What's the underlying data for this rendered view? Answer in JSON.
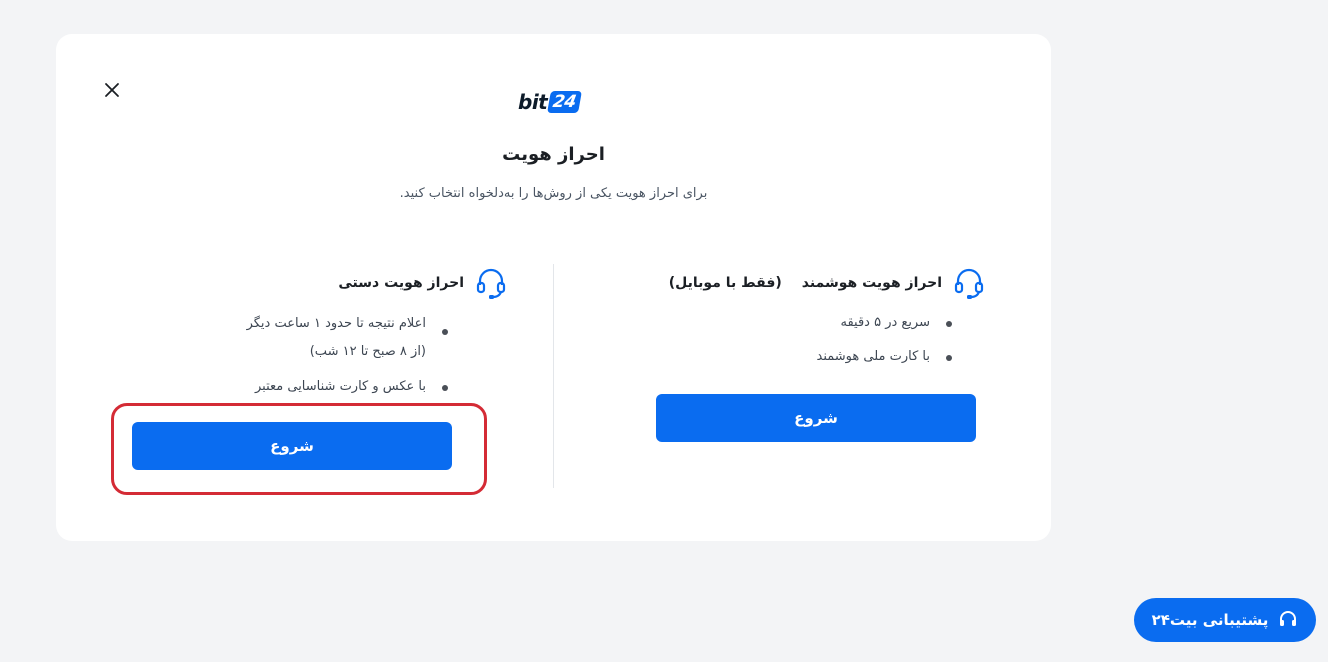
{
  "modal": {
    "logo": {
      "part1": "bit",
      "part2": "24"
    },
    "title": "احراز هویت",
    "subtitle": "برای احراز هویت یکی از روش‌ها را به‌دلخواه انتخاب کنید.",
    "smart": {
      "title": "احراز هویت هوشمند",
      "note": "(فقط با موبایل)",
      "bullets": [
        "سریع در ۵ دقیقه",
        "با کارت ملی هوشمند"
      ],
      "button": "شروع"
    },
    "manual": {
      "title": "احراز هویت دستی",
      "bullets": [
        "اعلام نتیجه تا حدود ۱ ساعت دیگر",
        "(از ۸ صبح تا ۱۲ شب)",
        "با عکس و کارت شناسایی معتبر"
      ],
      "button": "شروع"
    }
  },
  "support": {
    "label": "پشتیبانی بیت۲۴"
  },
  "colors": {
    "accent": "#0a6cf0",
    "highlight": "#d42b35"
  },
  "icons": [
    "close-icon",
    "headset-icon",
    "headset-icon",
    "headset-icon"
  ]
}
